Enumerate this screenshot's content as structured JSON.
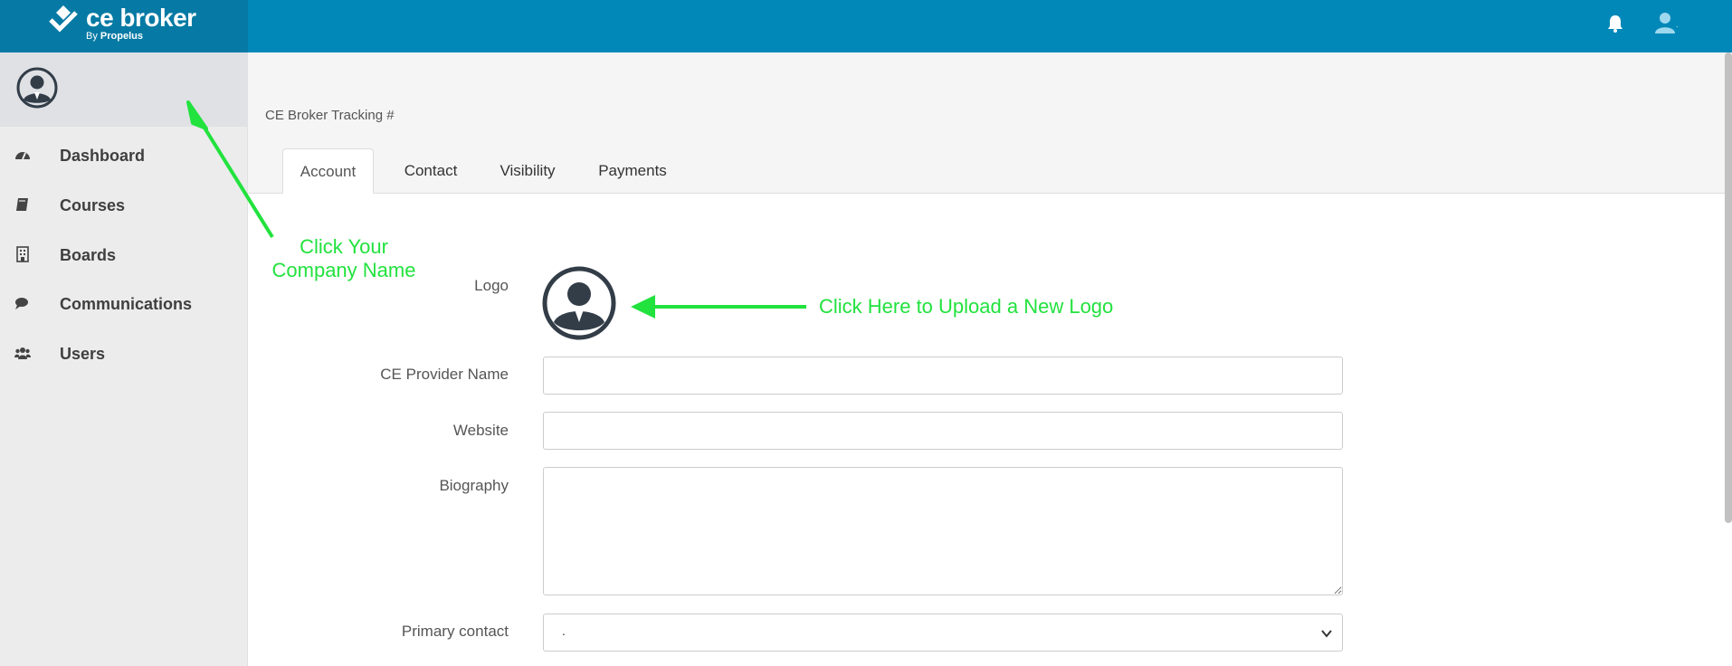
{
  "brand": {
    "name": "ce broker",
    "by": "By",
    "owner": "Propelus",
    "color": "#067aa4"
  },
  "topbar": {
    "color": "#0288b8",
    "icons": [
      "bell-icon",
      "user-icon"
    ],
    "user_caret": "."
  },
  "sidebar": {
    "company_avatar": "user-circle-icon",
    "items": [
      {
        "label": "Dashboard",
        "icon": "dashboard-icon"
      },
      {
        "label": "Courses",
        "icon": "book-icon"
      },
      {
        "label": "Boards",
        "icon": "building-icon"
      },
      {
        "label": "Communications",
        "icon": "comments-icon"
      },
      {
        "label": "Users",
        "icon": "users-icon"
      }
    ]
  },
  "main": {
    "tracking_label": "CE Broker Tracking #",
    "tabs": [
      {
        "label": "Account",
        "active": true
      },
      {
        "label": "Contact",
        "active": false
      },
      {
        "label": "Visibility",
        "active": false
      },
      {
        "label": "Payments",
        "active": false
      }
    ],
    "form": {
      "logo_label": "Logo",
      "provider_name_label": "CE Provider Name",
      "provider_name_value": "",
      "website_label": "Website",
      "website_value": "",
      "biography_label": "Biography",
      "biography_value": "",
      "primary_contact_label": "Primary contact",
      "primary_contact_value": "."
    }
  },
  "annotations": {
    "company_hint_line1": "Click Your",
    "company_hint_line2": "Company Name",
    "logo_hint": "Click Here to Upload a New Logo",
    "color": "#22e23e"
  }
}
